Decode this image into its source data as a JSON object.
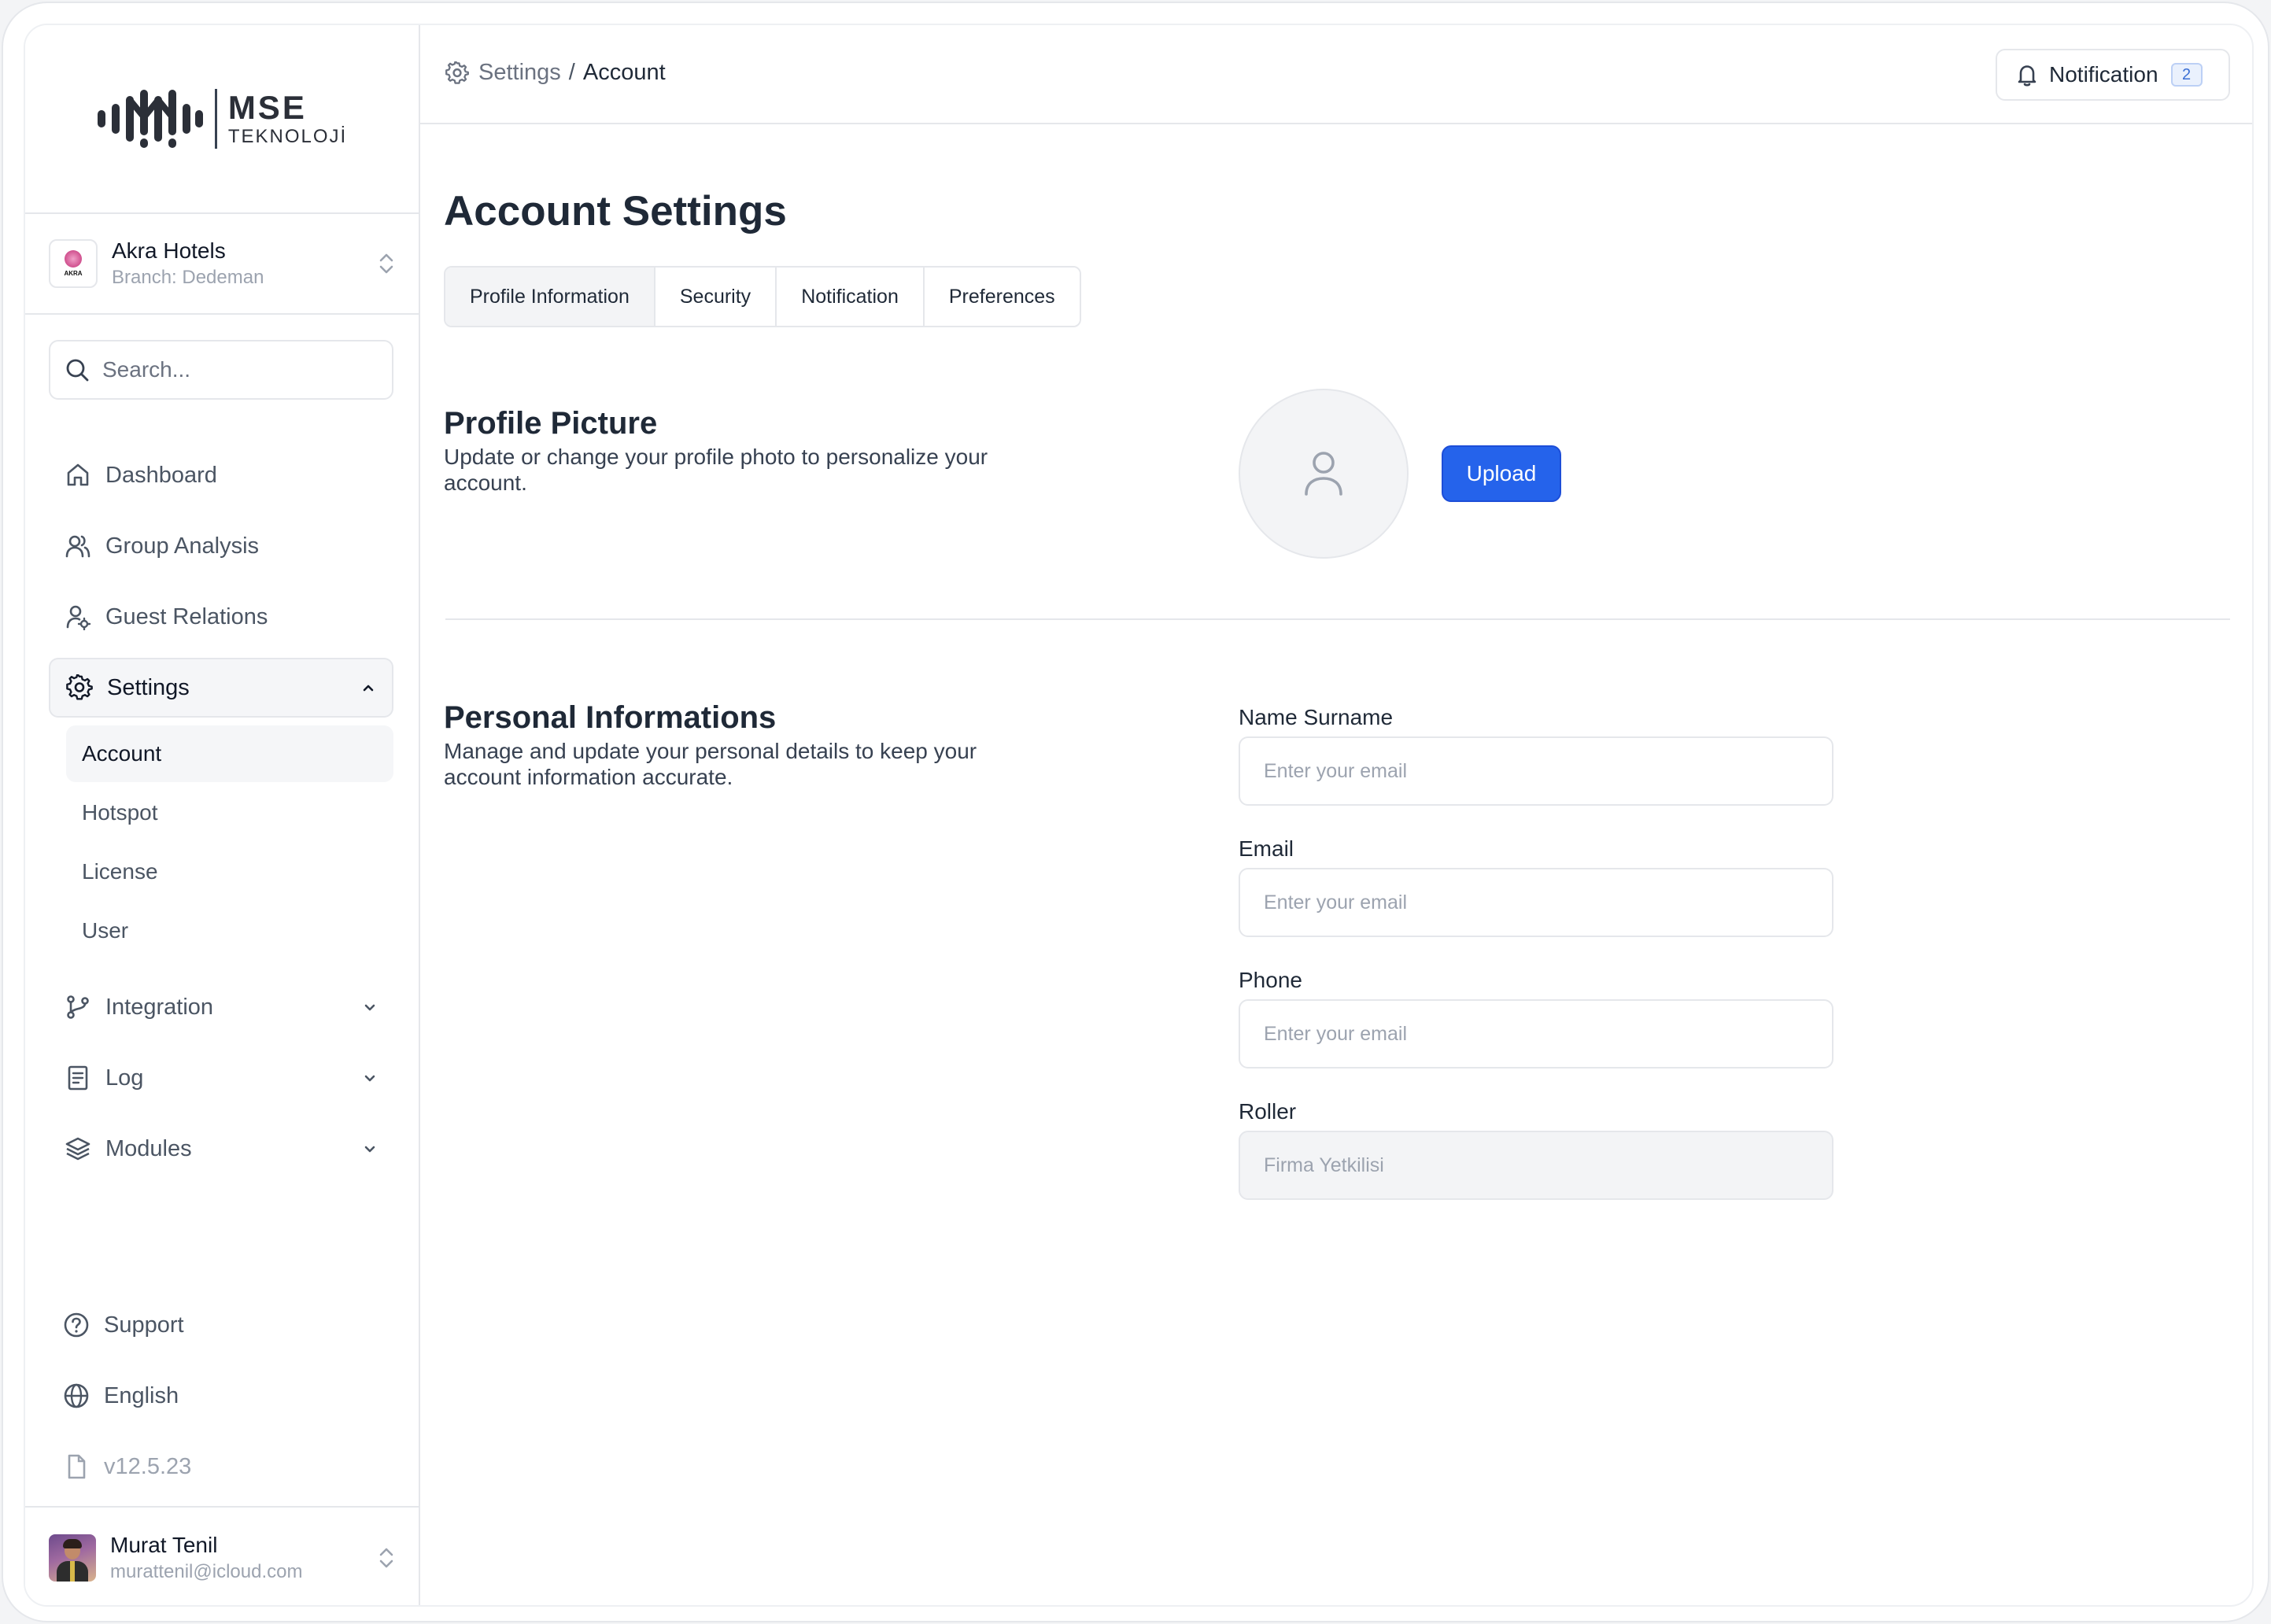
{
  "brand": {
    "name": "MSE",
    "subtitle": "TEKNOLOJİ"
  },
  "organization": {
    "name": "Akra Hotels",
    "branch": "Branch: Dedeman",
    "logo_text": "AKRA"
  },
  "search": {
    "placeholder": "Search..."
  },
  "nav": {
    "dashboard": "Dashboard",
    "group_analysis": "Group Analysis",
    "guest_relations": "Guest Relations",
    "settings": "Settings",
    "settings_sub": {
      "account": "Account",
      "hotspot": "Hotspot",
      "license": "License",
      "user": "User"
    },
    "integration": "Integration",
    "log": "Log",
    "modules": "Modules"
  },
  "footer": {
    "support": "Support",
    "language": "English",
    "version": "v12.5.23"
  },
  "user": {
    "name": "Murat Tenil",
    "email": "murattenil@icloud.com"
  },
  "breadcrumb": {
    "parent": "Settings",
    "separator": "/",
    "current": "Account"
  },
  "notification": {
    "label": "Notification",
    "count": "2"
  },
  "page": {
    "title": "Account Settings"
  },
  "tabs": {
    "profile": "Profile Information",
    "security": "Security",
    "notification": "Notification",
    "preferences": "Preferences"
  },
  "profile_picture": {
    "title": "Profile Picture",
    "description": "Update or change your profile photo to personalize your account.",
    "upload_label": "Upload"
  },
  "personal": {
    "title": "Personal Informations",
    "description": "Manage and update your personal details to keep your account information accurate.",
    "fields": {
      "name": {
        "label": "Name Surname",
        "placeholder": "Enter your email",
        "value": ""
      },
      "email": {
        "label": "Email",
        "placeholder": "Enter your email",
        "value": ""
      },
      "phone": {
        "label": "Phone",
        "placeholder": "Enter your email",
        "value": ""
      },
      "role": {
        "label": "Roller",
        "placeholder": "Firma Yetkilisi",
        "value": ""
      }
    }
  },
  "colors": {
    "primary": "#2563eb",
    "border": "#e5e7eb",
    "muted_text": "#9ca3af"
  }
}
